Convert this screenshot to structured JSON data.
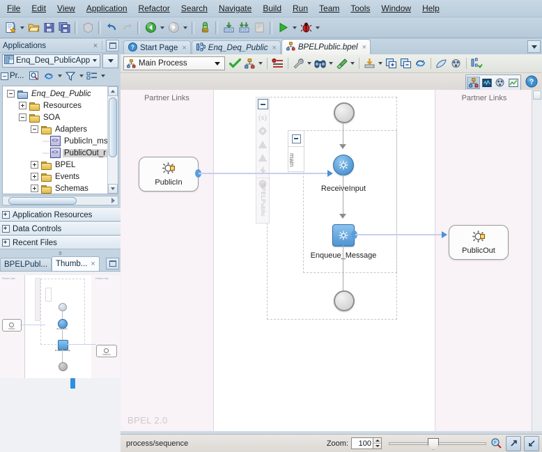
{
  "menubar": {
    "items": [
      {
        "label": "File"
      },
      {
        "label": "Edit"
      },
      {
        "label": "View"
      },
      {
        "label": "Application"
      },
      {
        "label": "Refactor"
      },
      {
        "label": "Search"
      },
      {
        "label": "Navigate"
      },
      {
        "label": "Build"
      },
      {
        "label": "Run"
      },
      {
        "label": "Team"
      },
      {
        "label": "Tools"
      },
      {
        "label": "Window"
      },
      {
        "label": "Help"
      }
    ]
  },
  "toolbar": {
    "buttons": [
      {
        "name": "new-icon"
      },
      {
        "name": "open-icon"
      },
      {
        "name": "save-icon"
      },
      {
        "name": "save-all-icon"
      },
      {
        "name": "rollback-icon"
      },
      {
        "name": "undo-icon"
      },
      {
        "name": "redo-icon"
      },
      {
        "name": "back-icon"
      },
      {
        "name": "forward-icon"
      },
      {
        "name": "sql-worksheet-icon"
      },
      {
        "name": "compile-icon"
      },
      {
        "name": "compile-all-icon"
      },
      {
        "name": "make-icon"
      },
      {
        "name": "run-icon"
      },
      {
        "name": "debug-icon"
      }
    ]
  },
  "applications_panel": {
    "title": "Applications",
    "close_label": "×",
    "selected_application": "Enq_Deq_PublicApp",
    "projects_tab_label": "Pr...",
    "tree": [
      {
        "indent": 0,
        "label": "Enq_Deq_Public",
        "icon": "folder-blue-icon",
        "expander": "minus",
        "italic": true,
        "selected": false
      },
      {
        "indent": 1,
        "label": "Resources",
        "icon": "folder-icon",
        "expander": "plus",
        "italic": false,
        "selected": false
      },
      {
        "indent": 1,
        "label": "SOA",
        "icon": "folder-icon",
        "expander": "minus",
        "italic": false,
        "selected": false
      },
      {
        "indent": 2,
        "label": "Adapters",
        "icon": "folder-icon",
        "expander": "minus",
        "italic": false,
        "selected": false
      },
      {
        "indent": 3,
        "label": "PublicIn_ms",
        "icon": "xml-file-icon",
        "expander": "none",
        "italic": false,
        "selected": false
      },
      {
        "indent": 3,
        "label": "PublicOut_r",
        "icon": "xml-file-icon",
        "expander": "none",
        "italic": false,
        "selected": true
      },
      {
        "indent": 2,
        "label": "BPEL",
        "icon": "folder-icon",
        "expander": "plus",
        "italic": false,
        "selected": false
      },
      {
        "indent": 2,
        "label": "Events",
        "icon": "folder-icon",
        "expander": "plus",
        "italic": false,
        "selected": false
      },
      {
        "indent": 2,
        "label": "Schemas",
        "icon": "folder-icon",
        "expander": "plus",
        "italic": false,
        "selected": false
      }
    ],
    "accordions": [
      {
        "label": "Application Resources"
      },
      {
        "label": "Data Controls"
      },
      {
        "label": "Recent Files"
      }
    ]
  },
  "dock": {
    "tabs": [
      {
        "label": "BPELPubl...",
        "active": false,
        "closable": false
      },
      {
        "label": "Thumb...",
        "active": true,
        "closable": true,
        "close_label": "×"
      }
    ],
    "thumbnail": {
      "left_lane_label": "Partner Links",
      "right_lane_label": "Partner Links",
      "nodes": [
        "PublicIn",
        "ReceiveInput",
        "Enqueue_Message",
        "PublicOut"
      ]
    }
  },
  "editor": {
    "tabs": [
      {
        "label": "Start Page",
        "icon": "help-circle-icon",
        "active": false,
        "italic": false,
        "close_label": "×"
      },
      {
        "label": "Enq_Deq_Public",
        "icon": "composite-icon",
        "active": false,
        "italic": true,
        "close_label": "×"
      },
      {
        "label": "BPELPublic.bpel",
        "icon": "bpel-icon",
        "active": true,
        "italic": true,
        "close_label": "×"
      }
    ],
    "process_selector": {
      "value": "Main Process",
      "icon": "bpel-icon"
    },
    "toolbar_buttons": [
      {
        "name": "validate-icon"
      },
      {
        "name": "bpel-structure-icon",
        "has_caret": true
      },
      {
        "name": "breakpoints-icon"
      },
      {
        "name": "properties-wrench-icon",
        "has_caret": true
      },
      {
        "name": "find-binoculars-icon",
        "has_caret": true
      },
      {
        "name": "paint-icon",
        "has_caret": true
      },
      {
        "name": "import-icon",
        "has_caret": true
      },
      {
        "name": "expand-all-icon"
      },
      {
        "name": "collapse-all-icon"
      },
      {
        "name": "refresh-icon"
      },
      {
        "name": "print-diagram-icon"
      },
      {
        "name": "image-export-icon"
      },
      {
        "name": "sensors-icon"
      }
    ],
    "view_buttons": [
      {
        "name": "design-view-icon",
        "active": true
      },
      {
        "name": "monitor-view-icon",
        "active": false
      },
      {
        "name": "source-view-icon",
        "active": false
      },
      {
        "name": "history-view-icon",
        "active": false
      }
    ],
    "help_button": {
      "name": "help-icon",
      "label": "?"
    }
  },
  "diagram": {
    "left_lane_label": "Partner Links",
    "right_lane_label": "Partner Links",
    "bpel_version_watermark": "BPEL 2.0",
    "scope_label": "main",
    "palette_vertical_label": "BPELPublic",
    "palette_items": [
      {
        "name": "collapse-icon"
      },
      {
        "name": "variables-icon",
        "label": "(x)"
      },
      {
        "name": "correlation-sets-icon"
      },
      {
        "name": "fault-handlers-icon"
      },
      {
        "name": "catch-all-icon"
      },
      {
        "name": "event-handlers-icon"
      },
      {
        "name": "compensation-handler-icon"
      }
    ],
    "partner_links": [
      {
        "id": "publicin",
        "label": "PublicIn",
        "icon": "adapter-gear-icon",
        "side": "left"
      },
      {
        "id": "publicout",
        "label": "PublicOut",
        "icon": "adapter-gear-icon",
        "side": "right"
      }
    ],
    "activities": [
      {
        "id": "start",
        "type": "start-event",
        "label": ""
      },
      {
        "id": "receiveinput",
        "type": "receive",
        "label": "ReceiveInput",
        "icon": "gear-icon"
      },
      {
        "id": "enqueue",
        "type": "invoke",
        "label": "Enqueue_Message",
        "icon": "gear-icon"
      },
      {
        "id": "end",
        "type": "end-event",
        "label": ""
      }
    ]
  },
  "statusbar": {
    "path": "process/sequence",
    "zoom_label": "Zoom:",
    "zoom_value": "100",
    "buttons": [
      {
        "name": "zoom-to-fit-icon"
      },
      {
        "name": "maximize-editor-icon"
      },
      {
        "name": "restore-editor-icon"
      }
    ]
  },
  "colors": {
    "window_chrome": "#b8cada",
    "canvas_bg": "#faf6f8",
    "lane_bg": "#f9f2f6",
    "accent_blue": "#4a90d9",
    "link_line": "#c8cdf0",
    "selection_gray": "#d3d3d3"
  }
}
